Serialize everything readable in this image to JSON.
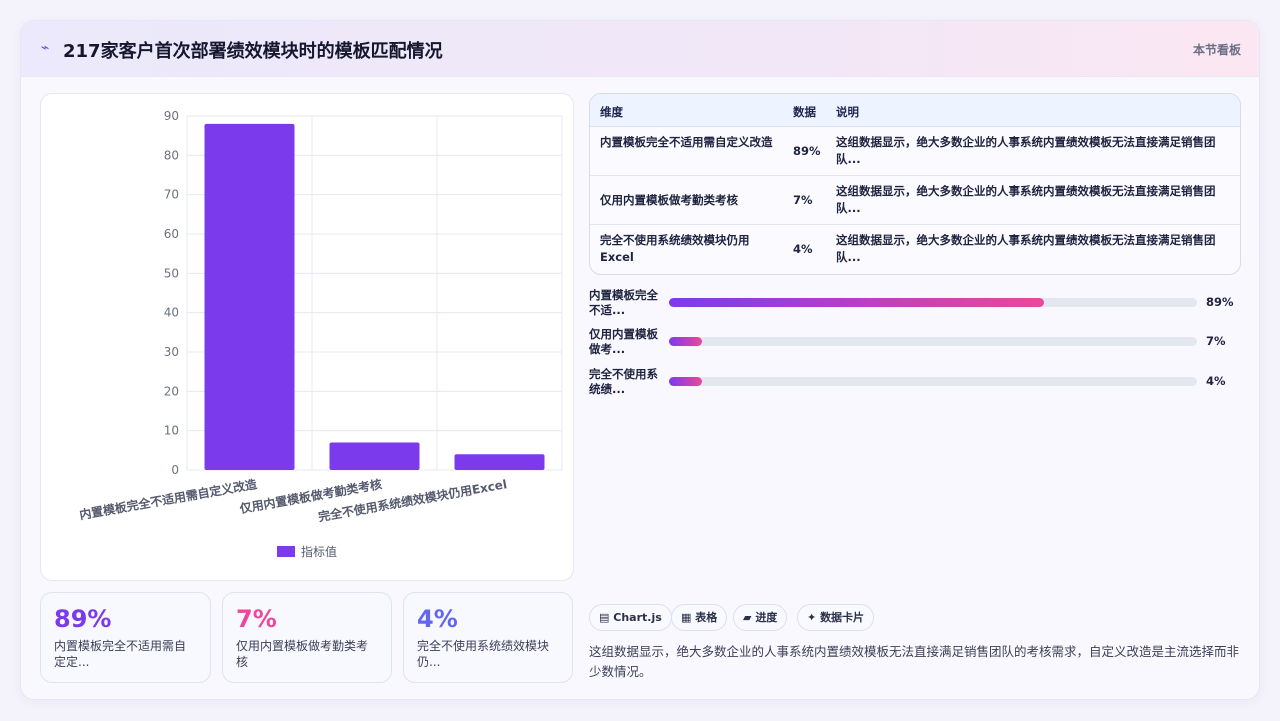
{
  "header": {
    "logo_icon": "spark-icon",
    "title": "217家客户首次部署绩效模块时的模板匹配情况",
    "right_label": "本节看板"
  },
  "colors": {
    "bar": "#7c3aed",
    "accent_pink": "#ec4899",
    "accent_blue": "#6366f1"
  },
  "chart_data": {
    "type": "bar",
    "categories": [
      "内置模板完全不适用需自定义改造",
      "仅用内置模板做考勤类考核",
      "完全不使用系统绩效模块仍用Excel"
    ],
    "series": [
      {
        "name": "指标值",
        "values": [
          88,
          7,
          4
        ]
      }
    ],
    "ylim": [
      0,
      90
    ],
    "yticks": [
      "0",
      "10",
      "20",
      "30",
      "40",
      "50",
      "60",
      "70",
      "80",
      "90"
    ],
    "legend": "bottom"
  },
  "stats": [
    {
      "value": "89%",
      "label": "内置模板完全不适用需自定定...",
      "color": "#7c3aed"
    },
    {
      "value": "7%",
      "label": "仅用内置模板做考勤类考核",
      "color": "#ec4899"
    },
    {
      "value": "4%",
      "label": "完全不使用系统绩效模块仍...",
      "color": "#6366f1"
    }
  ],
  "table": {
    "headers": {
      "dim": "维度",
      "data": "数据",
      "desc": "说明"
    },
    "rows": [
      {
        "dim": "内置模板完全不适用需自定义改造",
        "data": "89%",
        "desc": "这组数据显示，绝大多数企业的人事系统内置绩效模板无法直接满足销售团队..."
      },
      {
        "dim": "仅用内置模板做考勤类考核",
        "data": "7%",
        "desc": "这组数据显示，绝大多数企业的人事系统内置绩效模板无法直接满足销售团队..."
      },
      {
        "dim": "完全不使用系统绩效模块仍用Excel",
        "data": "4%",
        "desc": "这组数据显示，绝大多数企业的人事系统内置绩效模板无法直接满足销售团队..."
      }
    ]
  },
  "progress": [
    {
      "label": "内置模板完全不适...",
      "value": "89%",
      "fraction": 0.71
    },
    {
      "label": "仅用内置模板做考...",
      "value": "7%",
      "fraction": 0.063
    },
    {
      "label": "完全不使用系统绩...",
      "value": "4%",
      "fraction": 0.063
    }
  ],
  "chips": [
    {
      "icon": "chart-icon",
      "glyph": "▤",
      "label": "Chart.js"
    },
    {
      "icon": "table-icon",
      "glyph": "▦",
      "label": "表格"
    },
    {
      "icon": "progress-icon",
      "glyph": "▰",
      "label": "进度"
    },
    {
      "icon": "sparkle-icon",
      "glyph": "✦",
      "label": "数据卡片"
    }
  ],
  "summary": "这组数据显示，绝大多数企业的人事系统内置绩效模板无法直接满足销售团队的考核需求，自定义改造是主流选择而非少数情况。"
}
